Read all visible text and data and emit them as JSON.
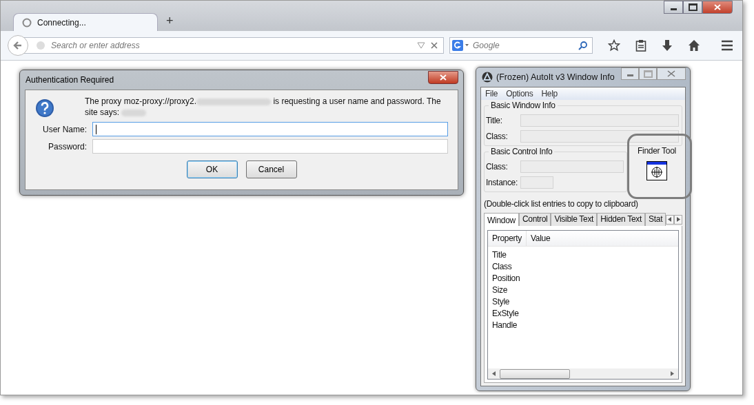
{
  "browser": {
    "tabs": [
      {
        "label": "Connecting...",
        "selected": true
      }
    ],
    "new_tab": "+",
    "address_bar": {
      "placeholder": "Search or enter address"
    },
    "search_bar": {
      "placeholder": "Google"
    }
  },
  "auth_dialog": {
    "title": "Authentication Required",
    "message_parts": [
      {
        "kind": "text",
        "text": "The proxy moz-proxy://proxy2."
      },
      {
        "kind": "redacted"
      },
      {
        "kind": "text",
        "text": " is requesting a user name and password. The site says: "
      },
      {
        "kind": "redacted"
      }
    ],
    "fields": [
      {
        "label": "User Name:",
        "focused": true
      },
      {
        "label": "Password:",
        "focused": false
      }
    ],
    "buttons": [
      {
        "label": "OK",
        "default": true
      },
      {
        "label": "Cancel",
        "default": false
      }
    ]
  },
  "autoit": {
    "title": "(Frozen) AutoIt v3 Window Info",
    "menu": [
      "File",
      "Options",
      "Help"
    ],
    "window_group": {
      "title": "Basic Window Info",
      "fields": [
        "Title:",
        "Class:"
      ]
    },
    "control_group": {
      "title": "Basic Control Info",
      "fields": [
        "Class:",
        "Instance:"
      ]
    },
    "finder": {
      "title": "Finder Tool",
      "highlighted": true
    },
    "hint": "(Double-click list entries to copy to clipboard)",
    "tabs": [
      {
        "label": "Window",
        "selected": true
      },
      {
        "label": "Control",
        "selected": false
      },
      {
        "label": "Visible Text",
        "selected": false
      },
      {
        "label": "Hidden Text",
        "selected": false
      },
      {
        "label": "Stat",
        "selected": false
      }
    ],
    "columns": [
      "Property",
      "Value"
    ],
    "rows": [
      "Title",
      "Class",
      "Position",
      "Size",
      "Style",
      "ExStyle",
      "Handle"
    ]
  }
}
